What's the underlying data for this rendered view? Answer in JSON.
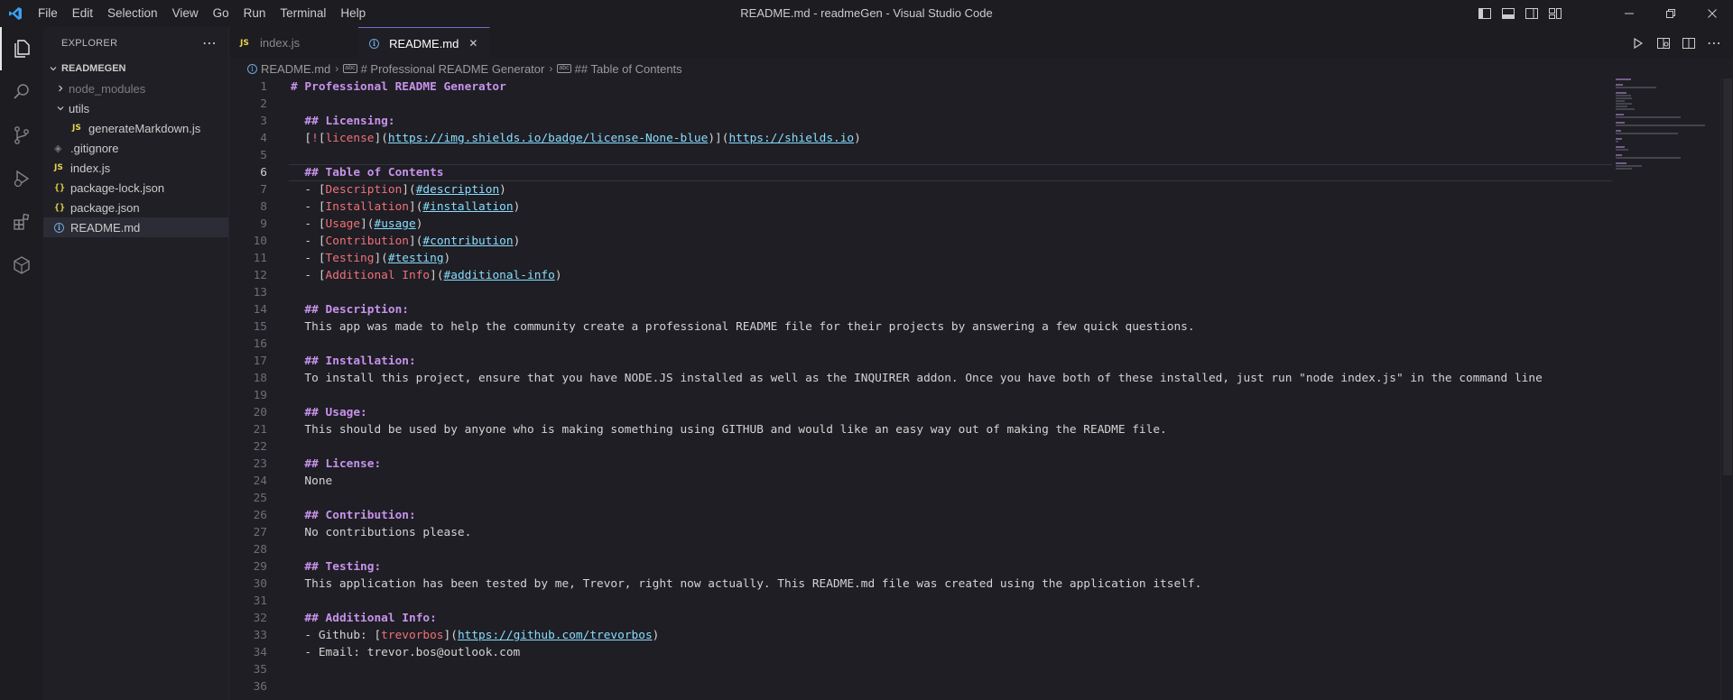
{
  "titlebar": {
    "menu": [
      "File",
      "Edit",
      "Selection",
      "View",
      "Go",
      "Run",
      "Terminal",
      "Help"
    ],
    "title": "README.md - readmeGen - Visual Studio Code"
  },
  "sidebar": {
    "header": "EXPLORER",
    "folder": "READMEGEN",
    "tree": [
      {
        "label": "node_modules",
        "kind": "folder",
        "state": "collapsed",
        "depth": 0,
        "dim": true
      },
      {
        "label": "utils",
        "kind": "folder",
        "state": "expanded",
        "depth": 0,
        "dim": false
      },
      {
        "label": "generateMarkdown.js",
        "kind": "js",
        "depth": 1,
        "dim": false
      },
      {
        "label": ".gitignore",
        "kind": "git",
        "depth": 0,
        "dim": false
      },
      {
        "label": "index.js",
        "kind": "js",
        "depth": 0,
        "dim": false
      },
      {
        "label": "package-lock.json",
        "kind": "json",
        "depth": 0,
        "dim": false
      },
      {
        "label": "package.json",
        "kind": "json",
        "depth": 0,
        "dim": false
      },
      {
        "label": "README.md",
        "kind": "info",
        "depth": 0,
        "dim": false,
        "selected": true
      }
    ]
  },
  "tabs": [
    {
      "label": "index.js",
      "kind": "js",
      "active": false
    },
    {
      "label": "README.md",
      "kind": "info",
      "active": true
    }
  ],
  "breadcrumb": [
    "README.md",
    "# Professional README Generator",
    "## Table of Contents"
  ],
  "editor": {
    "current_line": 6,
    "lines": [
      [
        [
          "h",
          "# Professional README Generator"
        ]
      ],
      [],
      [
        [
          "b",
          "  "
        ],
        [
          "h",
          "## Licensing:"
        ]
      ],
      [
        [
          "b",
          "  ["
        ],
        [
          "lt",
          "!"
        ],
        [
          "b",
          "["
        ],
        [
          "lt",
          "license"
        ],
        [
          "b",
          "]("
        ],
        [
          "lu",
          "https://img.shields.io/badge/license-None-blue"
        ],
        [
          "b",
          ")]("
        ],
        [
          "lu",
          "https://shields.io"
        ],
        [
          "b",
          ")"
        ]
      ],
      [],
      [
        [
          "b",
          "  "
        ],
        [
          "h",
          "## Table of Contents"
        ]
      ],
      [
        [
          "b",
          "  - ["
        ],
        [
          "lt",
          "Description"
        ],
        [
          "b",
          "]("
        ],
        [
          "lu",
          "#description"
        ],
        [
          "b",
          ")"
        ]
      ],
      [
        [
          "b",
          "  - ["
        ],
        [
          "lt",
          "Installation"
        ],
        [
          "b",
          "]("
        ],
        [
          "lu",
          "#installation"
        ],
        [
          "b",
          ")"
        ]
      ],
      [
        [
          "b",
          "  - ["
        ],
        [
          "lt",
          "Usage"
        ],
        [
          "b",
          "]("
        ],
        [
          "lu",
          "#usage"
        ],
        [
          "b",
          ")"
        ]
      ],
      [
        [
          "b",
          "  - ["
        ],
        [
          "lt",
          "Contribution"
        ],
        [
          "b",
          "]("
        ],
        [
          "lu",
          "#contribution"
        ],
        [
          "b",
          ")"
        ]
      ],
      [
        [
          "b",
          "  - ["
        ],
        [
          "lt",
          "Testing"
        ],
        [
          "b",
          "]("
        ],
        [
          "lu",
          "#testing"
        ],
        [
          "b",
          ")"
        ]
      ],
      [
        [
          "b",
          "  - ["
        ],
        [
          "lt",
          "Additional Info"
        ],
        [
          "b",
          "]("
        ],
        [
          "lu",
          "#additional-info"
        ],
        [
          "b",
          ")"
        ]
      ],
      [],
      [
        [
          "b",
          "  "
        ],
        [
          "h",
          "## Description:"
        ]
      ],
      [
        [
          "b",
          "  This app was made to help the community create a professional README file for their projects by answering a few quick questions."
        ]
      ],
      [],
      [
        [
          "b",
          "  "
        ],
        [
          "h",
          "## Installation:"
        ]
      ],
      [
        [
          "b",
          "  To install this project, ensure that you have NODE.JS installed as well as the INQUIRER addon. Once you have both of these installed, just run \"node index.js\" in the command line"
        ]
      ],
      [],
      [
        [
          "b",
          "  "
        ],
        [
          "h",
          "## Usage:"
        ]
      ],
      [
        [
          "b",
          "  This should be used by anyone who is making something using GITHUB and would like an easy way out of making the README file."
        ]
      ],
      [],
      [
        [
          "b",
          "  "
        ],
        [
          "h",
          "## License:"
        ]
      ],
      [
        [
          "b",
          "  None"
        ]
      ],
      [],
      [
        [
          "b",
          "  "
        ],
        [
          "h",
          "## Contribution:"
        ]
      ],
      [
        [
          "b",
          "  No contributions please."
        ]
      ],
      [],
      [
        [
          "b",
          "  "
        ],
        [
          "h",
          "## Testing:"
        ]
      ],
      [
        [
          "b",
          "  This application has been tested by me, Trevor, right now actually. This README.md file was created using the application itself."
        ]
      ],
      [],
      [
        [
          "b",
          "  "
        ],
        [
          "h",
          "## Additional Info:"
        ]
      ],
      [
        [
          "b",
          "  - Github: ["
        ],
        [
          "lt",
          "trevorbos"
        ],
        [
          "b",
          "]("
        ],
        [
          "lu",
          "https://github.com/trevorbos"
        ],
        [
          "b",
          ")"
        ]
      ],
      [
        [
          "b",
          "  - Email: trevor.bos@outlook.com"
        ]
      ],
      [],
      []
    ]
  },
  "colors": {
    "heading": "#c792ea",
    "link_text": "#f07178",
    "link_url": "#89ddff",
    "accent": "#6f6fd0"
  }
}
